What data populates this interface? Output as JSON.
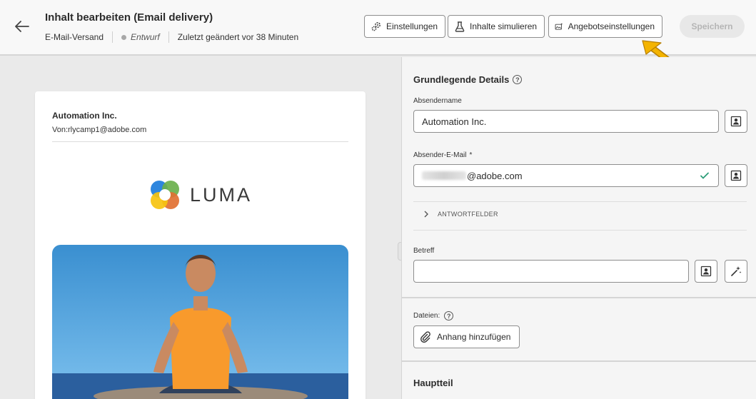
{
  "header": {
    "title": "Inhalt bearbeiten (Email delivery)",
    "channel": "E-Mail-Versand",
    "status": "Entwurf",
    "last_modified": "Zuletzt geändert vor 38 Minuten",
    "buttons": {
      "settings": "Einstellungen",
      "simulate": "Inhalte simulieren",
      "offer_settings": "Angebotseinstellungen",
      "save": "Speichern"
    }
  },
  "preview": {
    "sender_name": "Automation Inc.",
    "from": "Von:rlycamp1@adobe.com",
    "logo_text": "LUMA"
  },
  "panel": {
    "section_title": "Grundlegende Details",
    "sender_name_label": "Absendername",
    "sender_name_value": "Automation Inc.",
    "sender_email_label": "Absender-E-Mail",
    "sender_email_required": "*",
    "sender_email_value": "@adobe.com",
    "reply_fields": "ANTWORTFELDER",
    "subject_label": "Betreff",
    "subject_value": "",
    "files_label": "Dateien:",
    "attach_button": "Anhang hinzufügen",
    "body_title": "Hauptteil"
  },
  "colors": {
    "check": "#2d9d78",
    "callout_arrow": "#f4b400",
    "save_disabled": "#e8e8e8"
  }
}
